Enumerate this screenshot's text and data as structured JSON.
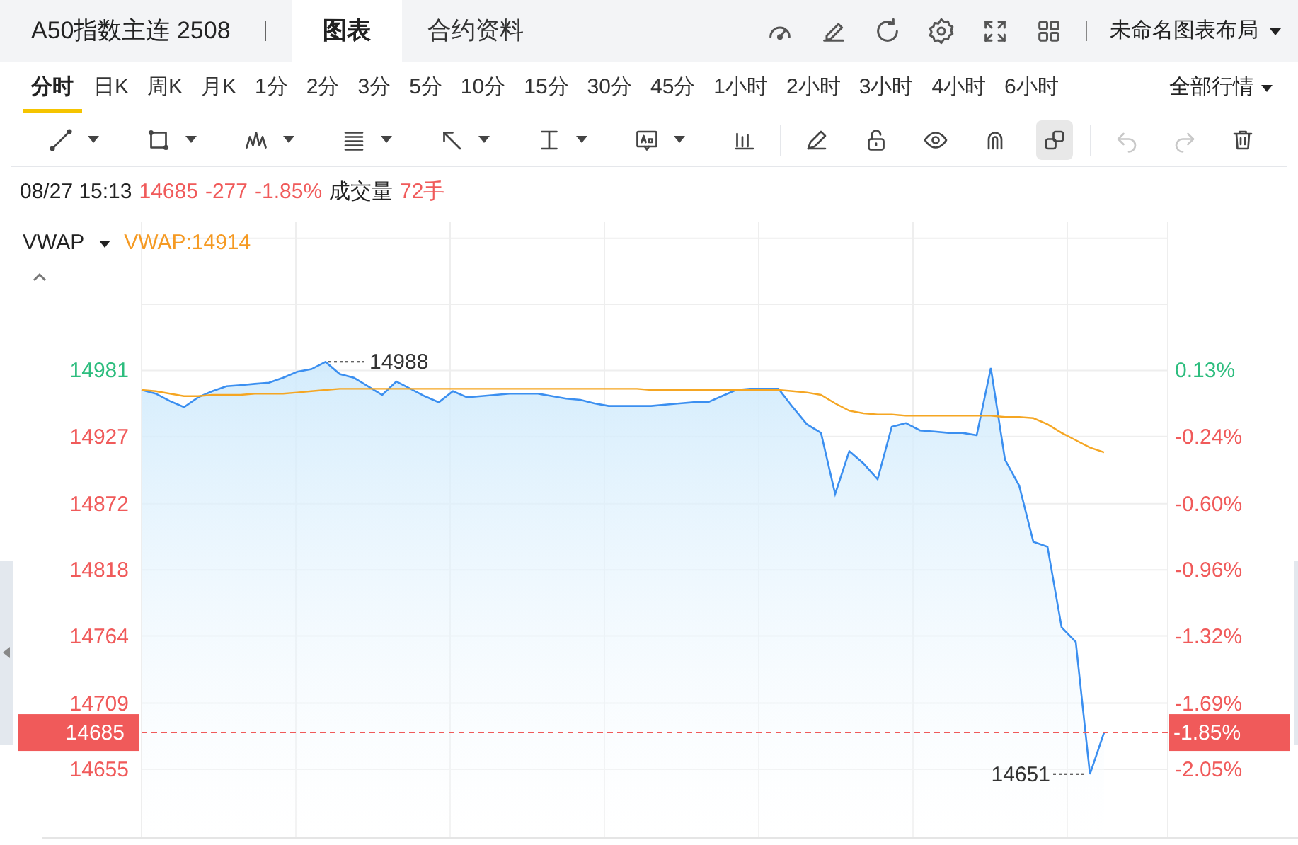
{
  "header": {
    "title": "A50指数主连 2508",
    "tabs": [
      {
        "label": "图表",
        "selected": true
      },
      {
        "label": "合约资料",
        "selected": false
      }
    ],
    "layout_menu": "未命名图表布局"
  },
  "periods": [
    {
      "label": "分时",
      "selected": true
    },
    {
      "label": "日K",
      "selected": false
    },
    {
      "label": "周K",
      "selected": false
    },
    {
      "label": "月K",
      "selected": false
    },
    {
      "label": "1分",
      "selected": false
    },
    {
      "label": "2分",
      "selected": false
    },
    {
      "label": "3分",
      "selected": false
    },
    {
      "label": "5分",
      "selected": false
    },
    {
      "label": "10分",
      "selected": false
    },
    {
      "label": "15分",
      "selected": false
    },
    {
      "label": "30分",
      "selected": false
    },
    {
      "label": "45分",
      "selected": false
    },
    {
      "label": "1小时",
      "selected": false
    },
    {
      "label": "2小时",
      "selected": false
    },
    {
      "label": "3小时",
      "selected": false
    },
    {
      "label": "4小时",
      "selected": false
    },
    {
      "label": "6小时",
      "selected": false
    }
  ],
  "market_menu": "全部行情",
  "tool_groups": [
    [
      {
        "has_menu": true,
        "selected": false,
        "disabled": false
      },
      {
        "has_menu": true,
        "selected": false,
        "disabled": false
      },
      {
        "has_menu": true,
        "selected": false,
        "disabled": false
      },
      {
        "has_menu": true,
        "selected": false,
        "disabled": false
      },
      {
        "has_menu": true,
        "selected": false,
        "disabled": false
      },
      {
        "has_menu": true,
        "selected": false,
        "disabled": false
      },
      {
        "has_menu": true,
        "selected": false,
        "disabled": false
      },
      {
        "has_menu": false,
        "selected": false,
        "disabled": false
      }
    ],
    [
      {
        "has_menu": false,
        "selected": false,
        "disabled": false
      },
      {
        "has_menu": false,
        "selected": false,
        "disabled": false
      },
      {
        "has_menu": false,
        "selected": false,
        "disabled": false
      },
      {
        "has_menu": false,
        "selected": false,
        "disabled": false
      },
      {
        "has_menu": false,
        "selected": true,
        "disabled": false
      }
    ],
    [
      {
        "has_menu": false,
        "selected": false,
        "disabled": true
      },
      {
        "has_menu": false,
        "selected": false,
        "disabled": true
      },
      {
        "has_menu": false,
        "selected": false,
        "disabled": false
      }
    ]
  ],
  "quote": {
    "time": "08/27 15:13",
    "price": "14685",
    "change": "-277",
    "change_pct": "-1.85%",
    "volume_label": "成交量",
    "volume": "72手"
  },
  "indicator": {
    "value": "VWAP:14914"
  },
  "chart_data": {
    "type": "line",
    "ylim": [
      14600,
      15101
    ],
    "grid": true,
    "ref_lines": [
      {
        "axis": "y",
        "value": 14685,
        "label": "14685"
      }
    ],
    "categories": [
      null,
      null,
      null,
      null,
      null,
      null,
      null,
      null,
      null,
      null,
      null,
      null,
      null,
      null,
      null,
      null,
      null,
      null,
      null,
      null,
      null,
      null,
      null,
      null,
      null,
      null,
      null,
      null,
      null,
      null,
      null,
      null,
      null,
      null,
      null,
      null,
      null,
      null,
      null,
      null,
      null,
      null,
      null,
      null,
      null,
      null,
      null,
      null,
      null,
      null,
      null,
      null,
      null,
      null,
      null,
      null,
      null,
      null,
      null,
      null,
      null,
      null,
      null,
      null,
      null,
      null,
      null,
      null,
      null,
      null,
      null,
      null,
      null
    ],
    "series": [
      {
        "color": "#3b8ff0",
        "values": [
          14965,
          14962,
          14956,
          14951,
          14959,
          14964,
          14968,
          14969,
          14970,
          14971,
          14975,
          14980,
          14982,
          14988,
          14978,
          14975,
          14968,
          14961,
          14972,
          14966,
          14960,
          14955,
          14964,
          14959,
          14960,
          14961,
          14962,
          14962,
          14962,
          14960,
          14958,
          14957,
          14954,
          14952,
          14952,
          14952,
          14952,
          14953,
          14954,
          14955,
          14955,
          14960,
          14965,
          14966,
          14966,
          14966,
          14951,
          14937,
          14930,
          14880,
          14915,
          14905,
          14892,
          14935,
          14938,
          14932,
          14931,
          14930,
          14930,
          14928,
          14983,
          14908,
          14887,
          14841,
          14837,
          14771,
          14759,
          14651,
          14685,
          null,
          null,
          null,
          null
        ]
      },
      {
        "name": "VWAP",
        "color": "#f5a623",
        "values": [
          14965,
          14964,
          14962,
          14960,
          14960,
          14961,
          14961,
          14961,
          14962,
          14962,
          14962,
          14963,
          14964,
          14965,
          14966,
          14966,
          14966,
          14966,
          14966,
          14966,
          14966,
          14966,
          14966,
          14966,
          14966,
          14966,
          14966,
          14966,
          14966,
          14966,
          14966,
          14966,
          14966,
          14966,
          14966,
          14966,
          14965,
          14965,
          14965,
          14965,
          14965,
          14965,
          14965,
          14965,
          14965,
          14965,
          14964,
          14963,
          14961,
          14954,
          14948,
          14946,
          14945,
          14945,
          14944,
          14944,
          14944,
          14944,
          14944,
          14944,
          14944,
          14943,
          14943,
          14942,
          14937,
          14930,
          14924,
          14918,
          14914,
          null,
          null,
          null,
          null
        ]
      }
    ],
    "yticks": [
      {
        "value": 14981,
        "label": "14981"
      },
      {
        "value": 14927,
        "label": "14927"
      },
      {
        "value": 14872,
        "label": "14872"
      },
      {
        "value": 14818,
        "label": "14818"
      },
      {
        "value": 14764,
        "label": "14764"
      },
      {
        "value": 14709,
        "label": "14709"
      },
      {
        "value": 14655,
        "label": "14655"
      }
    ]
  },
  "left_axis": [
    {
      "color": "#2dbd7e"
    },
    {
      "color": "#f05a5a"
    },
    {
      "color": "#f05a5a"
    },
    {
      "color": "#f05a5a"
    },
    {
      "color": "#f05a5a"
    },
    {
      "color": "#f05a5a"
    },
    {
      "color": "#f05a5a"
    }
  ],
  "right_axis": [
    {
      "label": "0.13%",
      "color": "#2dbd7e"
    },
    {
      "label": "-0.24%",
      "color": "#f05a5a"
    },
    {
      "label": "-0.60%",
      "color": "#f05a5a"
    },
    {
      "label": "-0.96%",
      "color": "#f05a5a"
    },
    {
      "label": "-1.32%",
      "color": "#f05a5a"
    },
    {
      "label": "-1.69%",
      "color": "#f05a5a"
    },
    {
      "label": "-2.05%",
      "color": "#f05a5a"
    }
  ],
  "extremes": {
    "high": "14988",
    "low": "14651"
  },
  "current_price": {
    "percent": "-1.85%"
  }
}
